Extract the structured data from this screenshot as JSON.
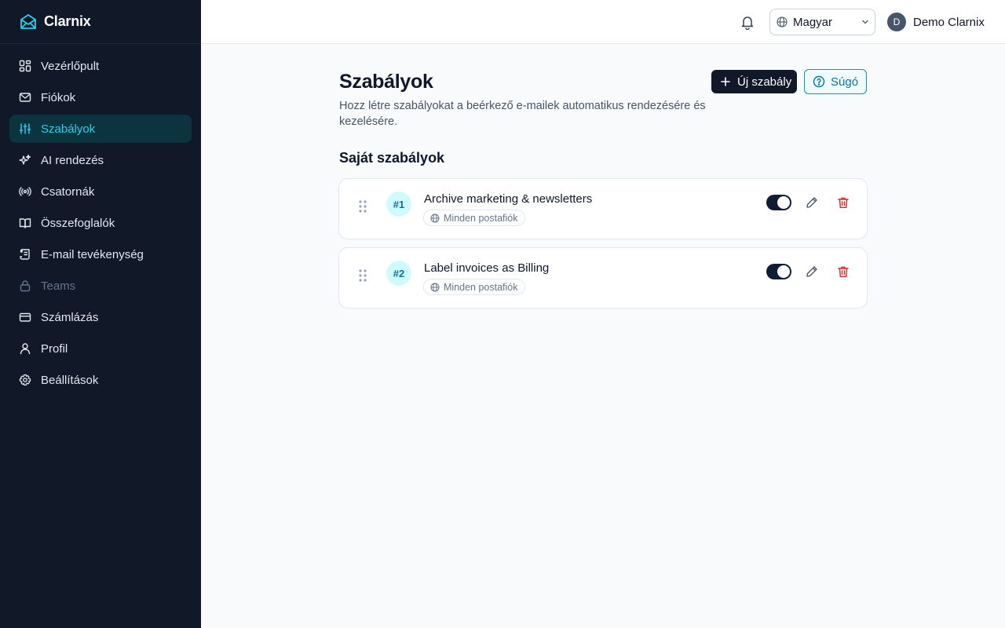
{
  "app": {
    "name": "Clarnix"
  },
  "sidebar": {
    "items": [
      {
        "label": "Vezérlőpult",
        "icon": "dashboard-icon",
        "state": "normal"
      },
      {
        "label": "Fiókok",
        "icon": "mail-icon",
        "state": "normal"
      },
      {
        "label": "Szabályok",
        "icon": "sliders-icon",
        "state": "active"
      },
      {
        "label": "AI rendezés",
        "icon": "sparkles-icon",
        "state": "normal"
      },
      {
        "label": "Csatornák",
        "icon": "broadcast-icon",
        "state": "normal"
      },
      {
        "label": "Összefoglalók",
        "icon": "book-icon",
        "state": "normal"
      },
      {
        "label": "E-mail tevékenység",
        "icon": "scroll-icon",
        "state": "normal"
      },
      {
        "label": "Teams",
        "icon": "lock-icon",
        "state": "disabled"
      },
      {
        "label": "Számlázás",
        "icon": "credit-card-icon",
        "state": "normal"
      },
      {
        "label": "Profil",
        "icon": "user-icon",
        "state": "normal"
      },
      {
        "label": "Beállítások",
        "icon": "gear-icon",
        "state": "normal"
      }
    ]
  },
  "header": {
    "language": "Magyar",
    "user": {
      "initial": "D",
      "name": "Demo Clarnix"
    }
  },
  "main": {
    "title": "Szabályok",
    "description": "Hozz létre szabályokat a beérkező e-mailek automatikus rendezésére és kezelésére.",
    "new_rule_label": "Új szabály",
    "help_label": "Súgó",
    "section_title": "Saját szabályok",
    "rules": [
      {
        "number": "#1",
        "name": "Archive marketing & newsletters",
        "scope": "Minden postafiók",
        "enabled": true
      },
      {
        "number": "#2",
        "name": "Label invoices as Billing",
        "scope": "Minden postafiók",
        "enabled": true
      }
    ]
  },
  "colors": {
    "sidebar_bg": "#111827",
    "accent": "#22d3ee",
    "active_bg": "#0c3340",
    "primary_button": "#111827",
    "danger": "#dc2626"
  }
}
